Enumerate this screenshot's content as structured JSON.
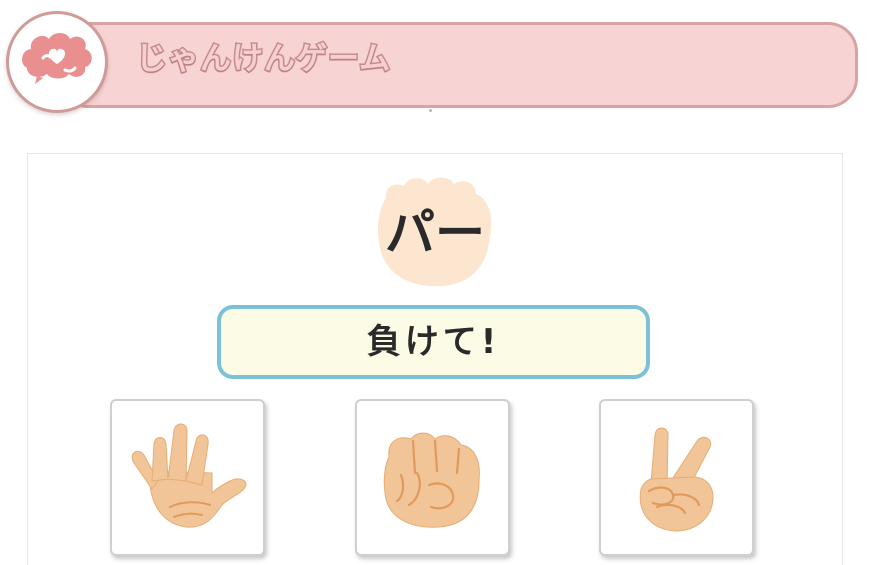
{
  "header": {
    "title": "じゃんけんゲーム",
    "logo_icon": "brain-heart-icon"
  },
  "game": {
    "cpu_hand": "パー",
    "instruction": "負けて!"
  },
  "choices": [
    {
      "id": "paper",
      "icon": "open-hand-paper-icon"
    },
    {
      "id": "rock",
      "icon": "fist-rock-icon"
    },
    {
      "id": "scissors",
      "icon": "peace-hand-scissors-icon"
    }
  ],
  "colors": {
    "banner_fill": "#f8d3d4",
    "banner_border": "#d8a4a3",
    "logo_pink": "#e98f8f",
    "instruction_fill": "#fcfce6",
    "instruction_border": "#7cc1d6",
    "hand_skin": "#f1c597",
    "hand_line": "#e19a5b",
    "cpu_hand_bg": "#fce6cf"
  }
}
